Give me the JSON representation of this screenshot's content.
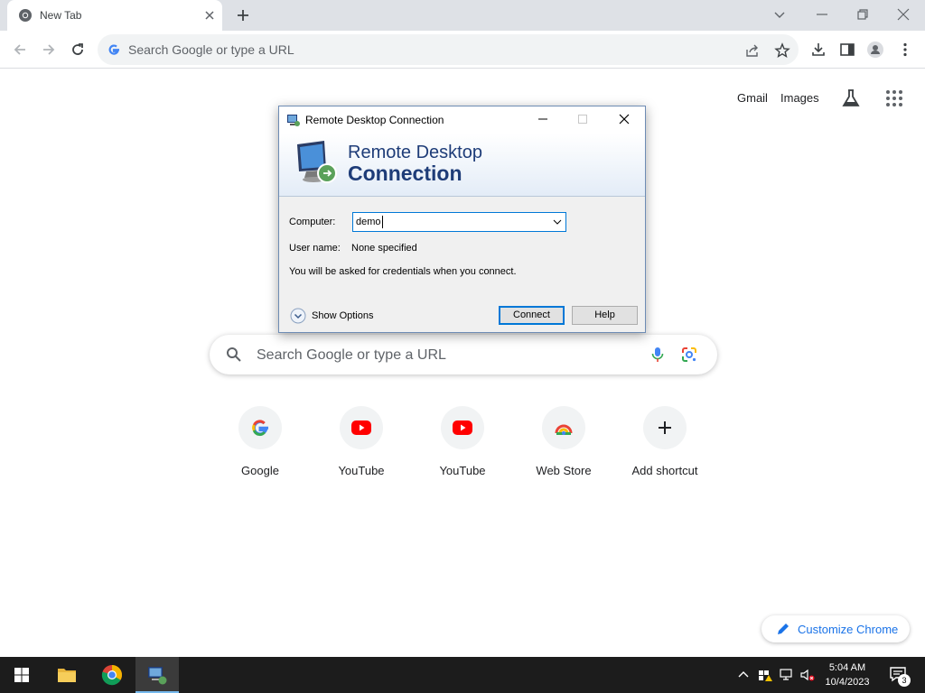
{
  "browser": {
    "tab": {
      "title": "New Tab"
    },
    "omnibox": {
      "placeholder": "Search Google or type a URL"
    }
  },
  "ntp": {
    "links": {
      "gmail": "Gmail",
      "images": "Images"
    },
    "search": {
      "placeholder": "Search Google or type a URL"
    },
    "shortcuts": [
      {
        "label": "Google",
        "icon": "google-icon"
      },
      {
        "label": "YouTube",
        "icon": "youtube-icon"
      },
      {
        "label": "YouTube",
        "icon": "youtube-icon"
      },
      {
        "label": "Web Store",
        "icon": "web-store-icon"
      },
      {
        "label": "Add shortcut",
        "icon": "plus-icon"
      }
    ],
    "customize": "Customize Chrome"
  },
  "rdp": {
    "window_title": "Remote Desktop Connection",
    "banner": {
      "line1": "Remote Desktop",
      "line2": "Connection"
    },
    "computer_label": "Computer:",
    "computer_value": "demo",
    "username_label": "User name:",
    "username_value": "None specified",
    "info": "You will be asked for credentials when you connect.",
    "show_options": "Show Options",
    "connect": "Connect",
    "help": "Help"
  },
  "taskbar": {
    "time": "5:04 AM",
    "date": "10/4/2023",
    "notifications": "3"
  },
  "colors": {
    "accent": "#1a73e8",
    "rdp_banner_text": "#1e3c78",
    "taskbar": "#1c1c1c"
  }
}
